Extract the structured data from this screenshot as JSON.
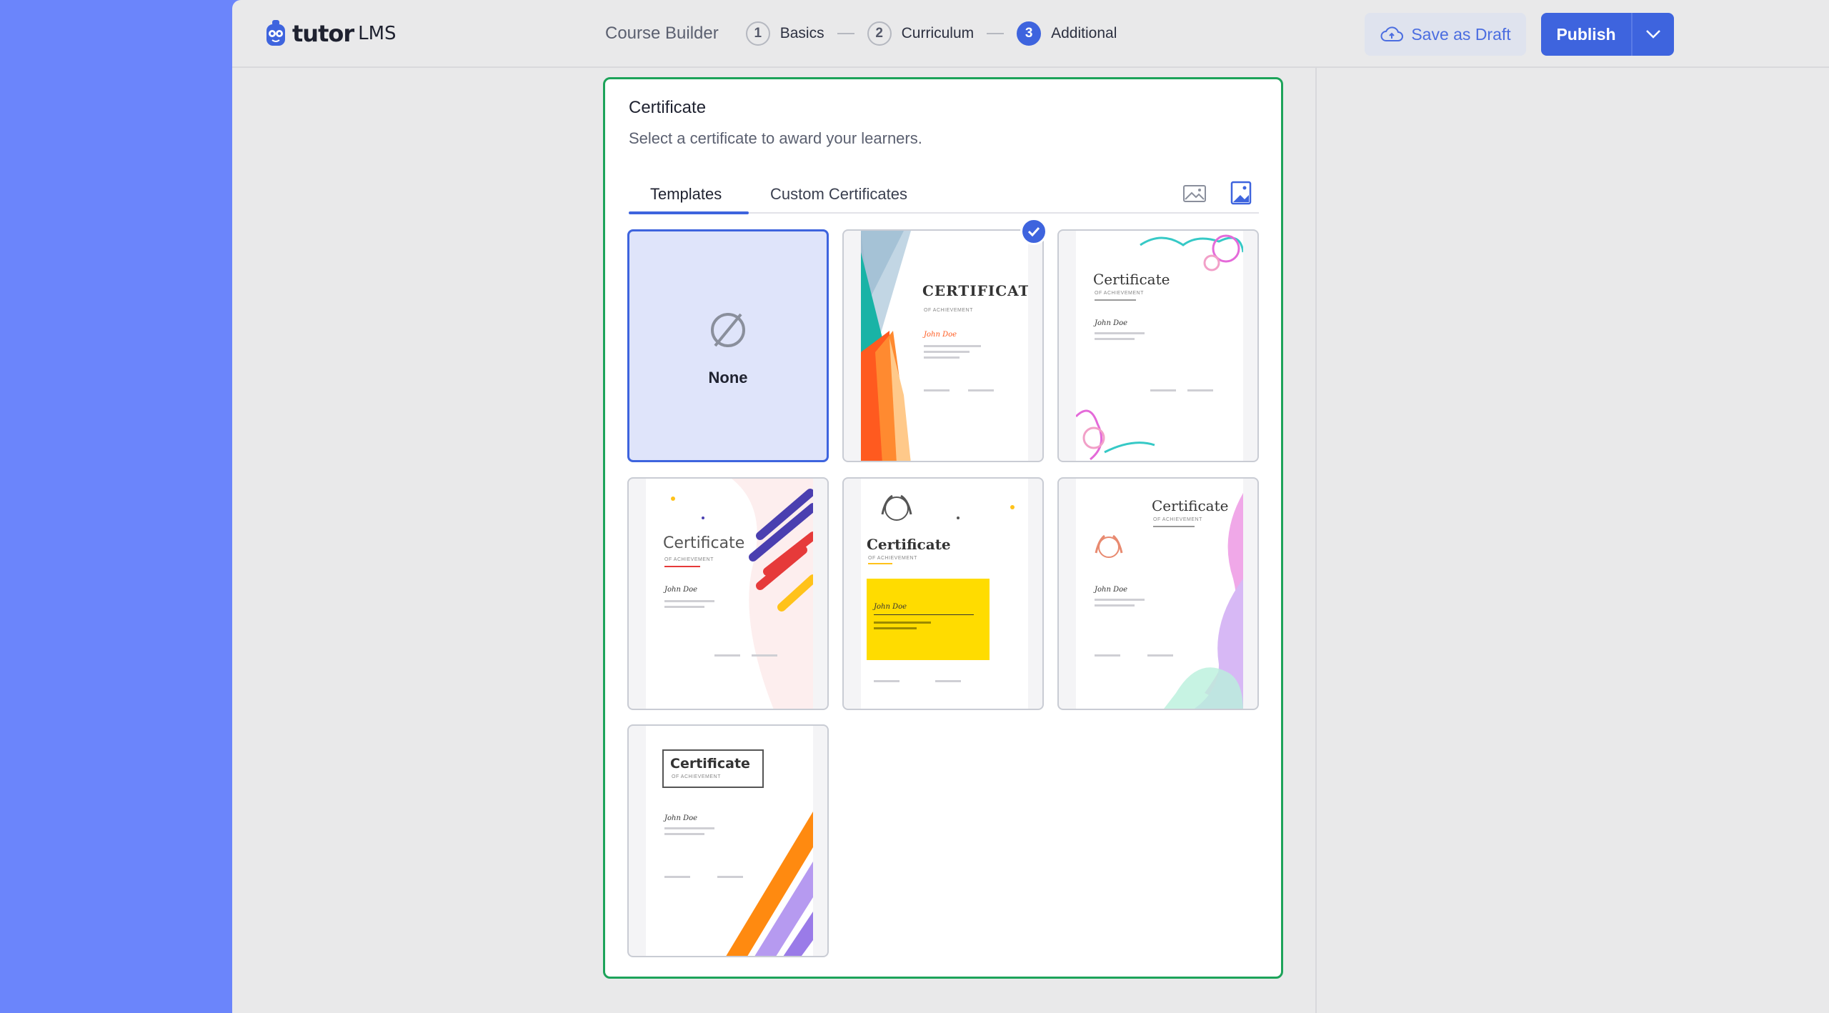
{
  "brand": {
    "name": "tutor",
    "suffix": "LMS"
  },
  "builder": {
    "title": "Course Builder",
    "steps": [
      {
        "number": "1",
        "label": "Basics"
      },
      {
        "number": "2",
        "label": "Curriculum"
      },
      {
        "number": "3",
        "label": "Additional",
        "active": true
      }
    ]
  },
  "actions": {
    "draft_label": "Save as Draft",
    "publish_label": "Publish"
  },
  "certificate": {
    "title": "Certificate",
    "subtitle": "Select a certificate to award your learners.",
    "tabs": [
      "Templates",
      "Custom Certificates"
    ],
    "active_tab": "Templates",
    "none_label": "None",
    "template_title_caps": "CERTIFICATE",
    "template_title": "Certificate",
    "template_subtitle": "OF ACHIEVEMENT",
    "template_name": "John Doe"
  },
  "colors": {
    "accent": "#3e64de",
    "card_border": "#1da35a",
    "sidebar": "#6b85fb"
  }
}
